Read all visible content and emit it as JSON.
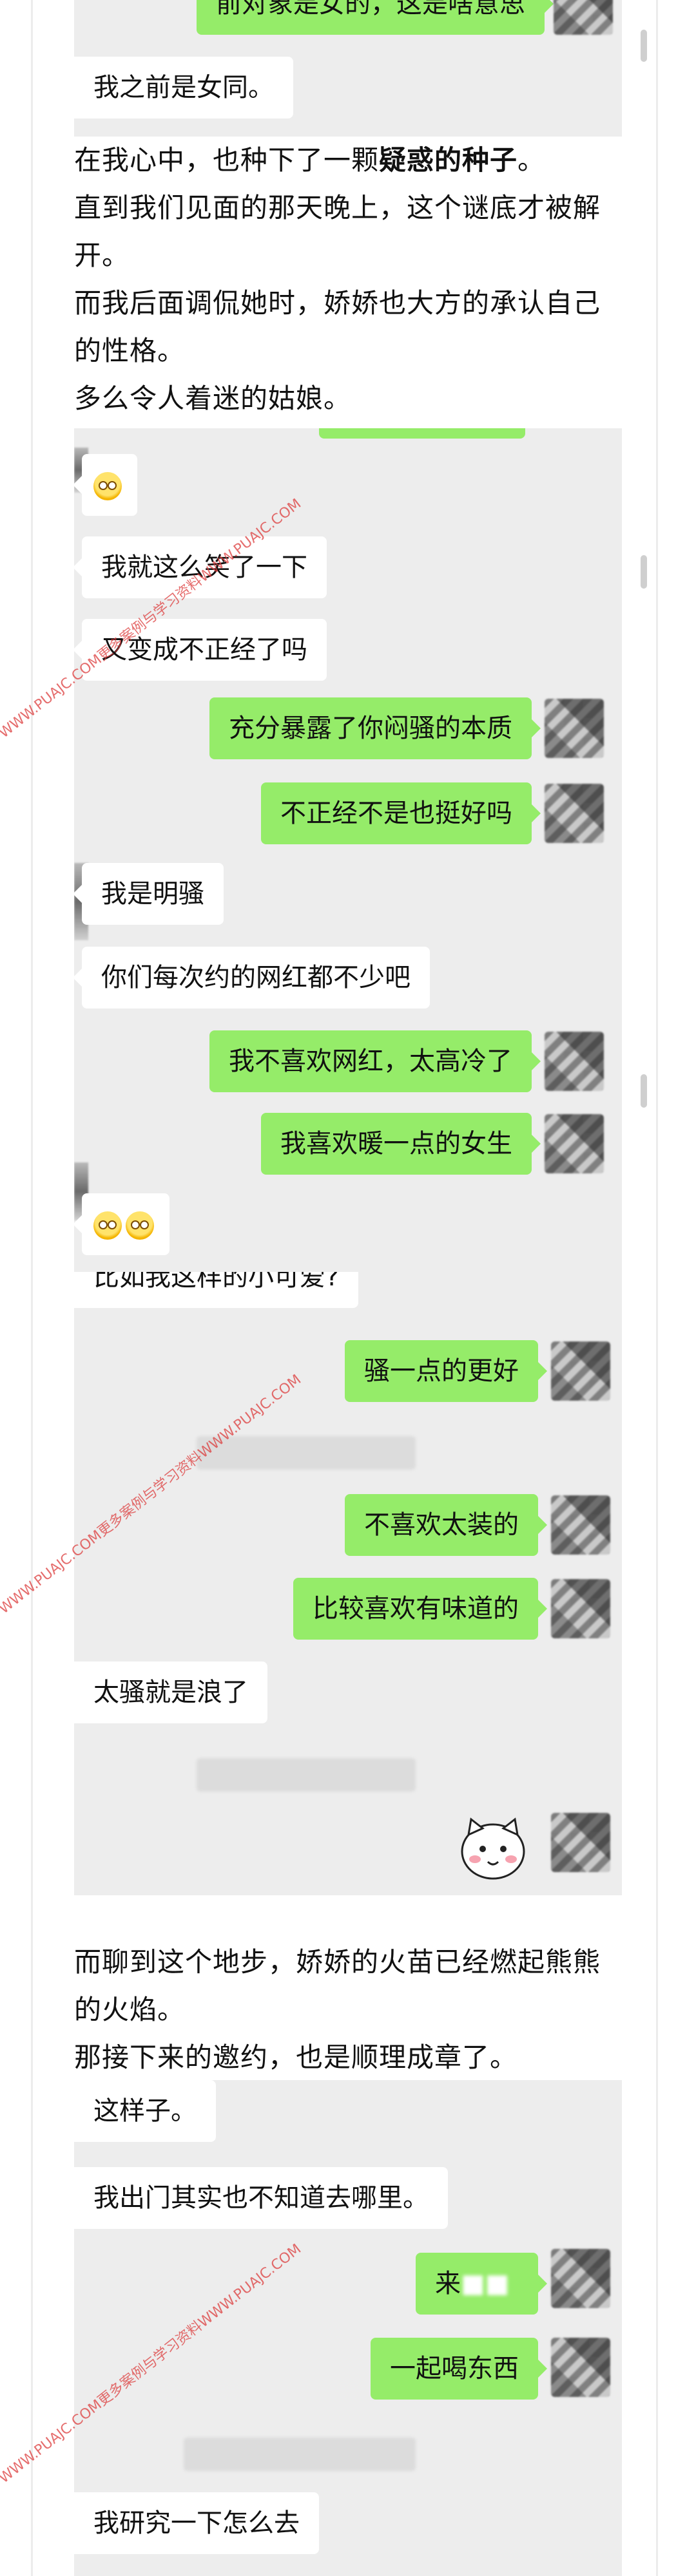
{
  "article": {
    "p1": "在我心中，也种下了一颗",
    "p1_bold": "疑惑的种子",
    "p1_end": "。",
    "p2": "直到我们见面的那天晚上，这个谜底才被解开。",
    "p3": "而我后面调侃她时，娇娇也大方的承认自己的性格。",
    "p4": "多么令人着迷的姑娘。",
    "p5": "而聊到这个地步，娇娇的火苗已经燃起熊熊的火焰。",
    "p6": "那接下来的邀约，也是顺理成章了。"
  },
  "chat1": {
    "top_partial": "前对象是女的，这是啥意思",
    "left_1": "我之前是女同。"
  },
  "chat2": {
    "left_emoji_count": "1",
    "left_1": "我就这么笑了一下",
    "left_2": "又变成不正经了吗",
    "right_1": "充分暴露了你闷骚的本质",
    "right_2": "不正经不是也挺好吗",
    "left_3": "我是明骚",
    "left_4": "你们每次约的网红都不少吧",
    "right_3": "我不喜欢网红，太高冷了",
    "right_4": "我喜欢暖一点的女生"
  },
  "chat3": {
    "left_top": "比如我这样的小可爱?",
    "right_1": "骚一点的更好",
    "right_2": "不喜欢太装的",
    "right_3": "比较喜欢有味道的",
    "left_1": "太骚就是浪了"
  },
  "chat4": {
    "left_1": "这样子。",
    "left_2": "我出门其实也不知道去哪里。",
    "right_1": "来",
    "right_2": "一起喝东西",
    "left_3": "我研究一下怎么去"
  },
  "watermark": "WWW.PUAJC.COM更多案例与学习资料WWW.PUAJC.COM",
  "colors": {
    "bubble_right": "#95ec69",
    "bubble_left": "#ffffff",
    "chat_bg": "#ededed",
    "watermark": "#dc3c3c"
  }
}
